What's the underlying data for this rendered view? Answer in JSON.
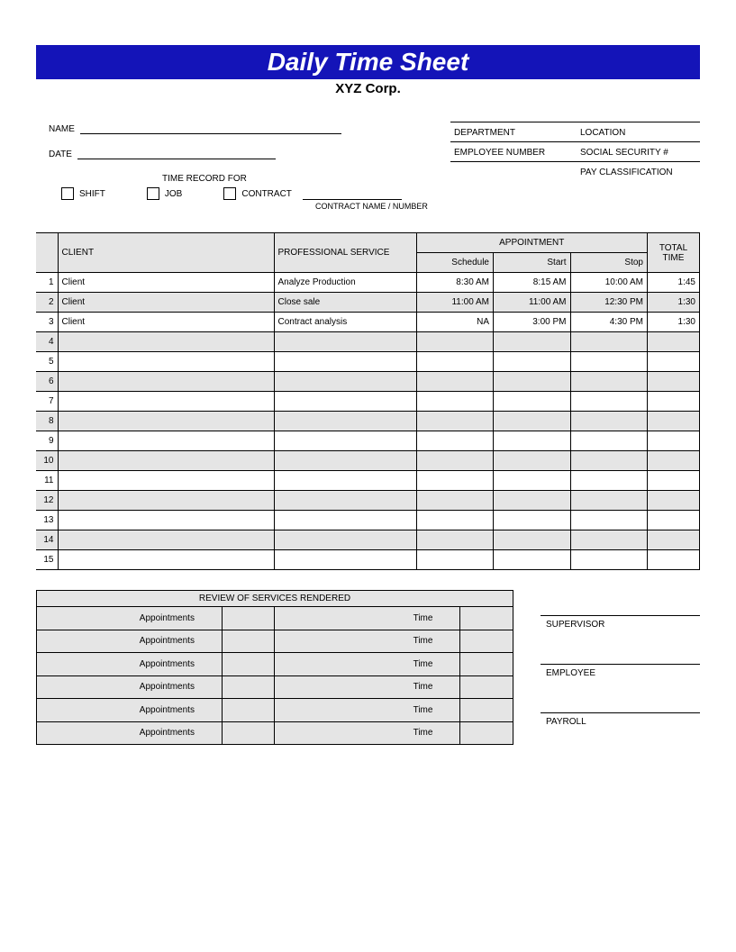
{
  "title": "Daily Time Sheet",
  "company": "XYZ Corp.",
  "fields": {
    "name_label": "NAME",
    "date_label": "DATE",
    "time_record_for": "TIME RECORD FOR",
    "shift": "SHIFT",
    "job": "JOB",
    "contract": "CONTRACT",
    "contract_sub": "CONTRACT NAME / NUMBER",
    "department": "DEPARTMENT",
    "location": "LOCATION",
    "employee_number": "EMPLOYEE NUMBER",
    "ssn": "SOCIAL SECURITY #",
    "pay_class": "PAY CLASSIFICATION"
  },
  "headers": {
    "client": "CLIENT",
    "professional_service": "PROFESSIONAL SERVICE",
    "appointment": "APPOINTMENT",
    "schedule": "Schedule",
    "start": "Start",
    "stop": "Stop",
    "total_time": "TOTAL TIME"
  },
  "rows": [
    {
      "n": "1",
      "client": "Client",
      "service": "Analyze Production",
      "schedule": "8:30 AM",
      "start": "8:15 AM",
      "stop": "10:00 AM",
      "total": "1:45"
    },
    {
      "n": "2",
      "client": "Client",
      "service": "Close sale",
      "schedule": "11:00 AM",
      "start": "11:00 AM",
      "stop": "12:30 PM",
      "total": "1:30"
    },
    {
      "n": "3",
      "client": "Client",
      "service": "Contract analysis",
      "schedule": "NA",
      "start": "3:00 PM",
      "stop": "4:30 PM",
      "total": "1:30"
    },
    {
      "n": "4",
      "client": "",
      "service": "",
      "schedule": "",
      "start": "",
      "stop": "",
      "total": ""
    },
    {
      "n": "5",
      "client": "",
      "service": "",
      "schedule": "",
      "start": "",
      "stop": "",
      "total": ""
    },
    {
      "n": "6",
      "client": "",
      "service": "",
      "schedule": "",
      "start": "",
      "stop": "",
      "total": ""
    },
    {
      "n": "7",
      "client": "",
      "service": "",
      "schedule": "",
      "start": "",
      "stop": "",
      "total": ""
    },
    {
      "n": "8",
      "client": "",
      "service": "",
      "schedule": "",
      "start": "",
      "stop": "",
      "total": ""
    },
    {
      "n": "9",
      "client": "",
      "service": "",
      "schedule": "",
      "start": "",
      "stop": "",
      "total": ""
    },
    {
      "n": "10",
      "client": "",
      "service": "",
      "schedule": "",
      "start": "",
      "stop": "",
      "total": ""
    },
    {
      "n": "11",
      "client": "",
      "service": "",
      "schedule": "",
      "start": "",
      "stop": "",
      "total": ""
    },
    {
      "n": "12",
      "client": "",
      "service": "",
      "schedule": "",
      "start": "",
      "stop": "",
      "total": ""
    },
    {
      "n": "13",
      "client": "",
      "service": "",
      "schedule": "",
      "start": "",
      "stop": "",
      "total": ""
    },
    {
      "n": "14",
      "client": "",
      "service": "",
      "schedule": "",
      "start": "",
      "stop": "",
      "total": ""
    },
    {
      "n": "15",
      "client": "",
      "service": "",
      "schedule": "",
      "start": "",
      "stop": "",
      "total": ""
    }
  ],
  "review": {
    "title": "REVIEW OF SERVICES RENDERED",
    "rows": [
      {
        "a": "Appointments",
        "t": "Time"
      },
      {
        "a": "Appointments",
        "t": "Time"
      },
      {
        "a": "Appointments",
        "t": "Time"
      },
      {
        "a": "Appointments",
        "t": "Time"
      },
      {
        "a": "Appointments",
        "t": "Time"
      },
      {
        "a": "Appointments",
        "t": "Time"
      }
    ]
  },
  "signatures": {
    "supervisor": "SUPERVISOR",
    "employee": "EMPLOYEE",
    "payroll": "PAYROLL"
  }
}
